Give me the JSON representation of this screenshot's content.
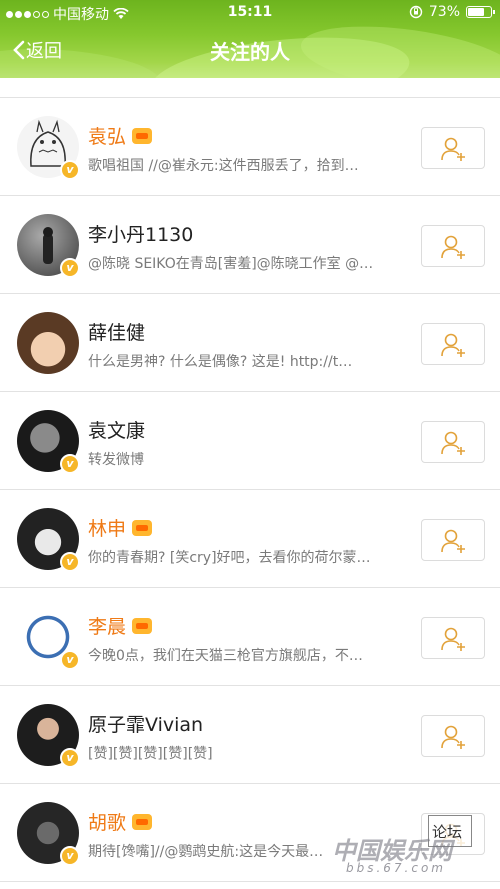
{
  "status_bar": {
    "carrier": "中国移动",
    "time": "15:11",
    "battery_pct": "73%"
  },
  "nav": {
    "back_label": "返回",
    "title": "关注的人"
  },
  "users": [
    {
      "name": "袁弘",
      "vip": true,
      "desc": "歌唱祖国 //@崔永元:这件西服丢了，拾到…"
    },
    {
      "name": "李小丹1130",
      "vip": false,
      "desc": "@陈晓 SEIKO在青岛[害羞]@陈晓工作室 @…"
    },
    {
      "name": "薛佳健",
      "vip": false,
      "desc": "什么是男神? 什么是偶像? 这是! http://t…"
    },
    {
      "name": "袁文康",
      "vip": false,
      "desc": "转发微博"
    },
    {
      "name": "林申",
      "vip": true,
      "desc": "你的青春期? [笑cry]好吧，去看你的荷尔蒙…"
    },
    {
      "name": "李晨",
      "vip": true,
      "desc": "今晚0点，我们在天猫三枪官方旗舰店，不…"
    },
    {
      "name": "原子霏Vivian",
      "vip": false,
      "desc": "[赞][赞][赞][赞][赞]"
    },
    {
      "name": "胡歌",
      "vip": true,
      "desc": "期待[馋嘴]//@鹦鹉史航:这是今天最…"
    }
  ],
  "watermark": {
    "text": "中国娱乐网",
    "subtext": "论坛",
    "url": "bbs.67.com"
  },
  "colors": {
    "accent_green": "#7cc128",
    "vip_orange": "#ef7a16",
    "badge_yellow": "#f6b628"
  }
}
